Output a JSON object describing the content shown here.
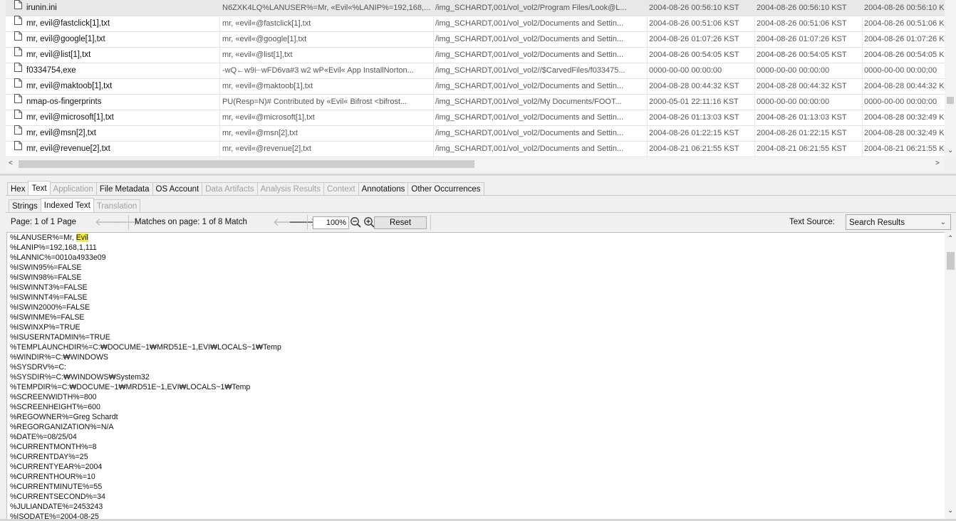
{
  "results": {
    "rows": [
      {
        "name": "irunin.ini",
        "keyword": "N6ZXK4LQ%LANUSER%=Mr, «Evil«%LANIP%=192,168,...",
        "path": "/img_SCHARDT,001/vol_vol2/Program Files/Look@L...",
        "modified": "2004-08-26 00:56:10 KST",
        "changed": "2004-08-26 00:56:10 KST",
        "accessed": "2004-08-26 00:56:10 K"
      },
      {
        "name": "mr, evil@fastclick[1],txt",
        "keyword": "mr, «evil«@fastclick[1],txt",
        "path": "/img_SCHARDT,001/vol_vol2/Documents and Settin...",
        "modified": "2004-08-26 00:51:06 KST",
        "changed": "2004-08-26 00:51:06 KST",
        "accessed": "2004-08-26 00:51:06 K"
      },
      {
        "name": "mr, evil@google[1],txt",
        "keyword": "mr, «evil«@google[1],txt",
        "path": "/img_SCHARDT,001/vol_vol2/Documents and Settin...",
        "modified": "2004-08-26 01:07:26 KST",
        "changed": "2004-08-26 01:07:26 KST",
        "accessed": "2004-08-26 01:07:26 K"
      },
      {
        "name": "mr, evil@list[1],txt",
        "keyword": "mr, «evil«@list[1],txt",
        "path": "/img_SCHARDT,001/vol_vol2/Documents and Settin...",
        "modified": "2004-08-26 00:54:05 KST",
        "changed": "2004-08-26 00:54:05 KST",
        "accessed": "2004-08-26 00:54:05 K"
      },
      {
        "name": "f0334754,exe",
        "keyword": "-wQ←w9⊢wFD6va#3 w2 wP«Evil« App InstallNorton...",
        "path": "/img_SCHARDT,001/vol_vol2//$CarvedFiles/f033475...",
        "modified": "0000-00-00 00:00:00",
        "changed": "0000-00-00 00:00:00",
        "accessed": "0000-00-00 00:00:00"
      },
      {
        "name": "mr, evil@maktoob[1],txt",
        "keyword": "mr, «evil«@maktoob[1],txt",
        "path": "/img_SCHARDT,001/vol_vol2/Documents and Settin...",
        "modified": "2004-08-28 00:44:32 KST",
        "changed": "2004-08-28 00:44:32 KST",
        "accessed": "2004-08-28 00:44:32 K"
      },
      {
        "name": "nmap-os-fingerprints",
        "keyword": "PU(Resp=N)# Contributed by «Evil« Bifrost <bifrost...",
        "path": "/img_SCHARDT,001/vol_vol2/My Documents/FOOT...",
        "modified": "2000-05-01 22:11:16 KST",
        "changed": "0000-00-00 00:00:00",
        "accessed": "0000-00-00 00:00:00"
      },
      {
        "name": "mr, evil@microsoft[1],txt",
        "keyword": "mr, «evil«@microsoft[1],txt",
        "path": "/img_SCHARDT,001/vol_vol2/Documents and Settin...",
        "modified": "2004-08-26 01:13:03 KST",
        "changed": "2004-08-26 01:13:03 KST",
        "accessed": "2004-08-28 00:32:49 K"
      },
      {
        "name": "mr, evil@msn[2],txt",
        "keyword": "mr, «evil«@msn[2],txt",
        "path": "/img_SCHARDT,001/vol_vol2/Documents and Settin...",
        "modified": "2004-08-26 01:22:15 KST",
        "changed": "2004-08-26 01:22:15 KST",
        "accessed": "2004-08-28 00:32:49 K"
      },
      {
        "name": "mr, evil@revenue[2],txt",
        "keyword": "mr, «evil«@revenue[2],txt",
        "path": "/img_SCHARDT,001/vol_vol2/Documents and Settin...",
        "modified": "2004-08-21 06:21:55 KST",
        "changed": "2004-08-21 06:21:55 KST",
        "accessed": "2004-08-21 06:21:55 K"
      }
    ]
  },
  "viewer_tabs": [
    {
      "label": "Hex",
      "state": "normal"
    },
    {
      "label": "Text",
      "state": "active"
    },
    {
      "label": "Application",
      "state": "disabled"
    },
    {
      "label": "File Metadata",
      "state": "normal"
    },
    {
      "label": "OS Account",
      "state": "normal"
    },
    {
      "label": "Data Artifacts",
      "state": "disabled"
    },
    {
      "label": "Analysis Results",
      "state": "disabled"
    },
    {
      "label": "Context",
      "state": "disabled"
    },
    {
      "label": "Annotations",
      "state": "normal"
    },
    {
      "label": "Other Occurrences",
      "state": "normal"
    }
  ],
  "text_tabs": [
    {
      "label": "Strings",
      "state": "normal"
    },
    {
      "label": "Indexed Text",
      "state": "active"
    },
    {
      "label": "Translation",
      "state": "disabled"
    }
  ],
  "toolbar": {
    "page_label": "Page: 1 of 1 Page",
    "matches_label": "Matches on page: 1 of 8 Match",
    "zoom_value": "100%",
    "reset_label": "Reset",
    "text_source_label": "Text Source:",
    "text_source_value": "Search Results"
  },
  "content": {
    "first_line_prefix": "%LANUSER%=Mr, ",
    "first_line_highlight": "Evil",
    "lines": [
      "%LANIP%=192,168,1,111",
      "%LANNIC%=0010a4933e09",
      "%ISWIN95%=FALSE",
      "%ISWIN98%=FALSE",
      "%ISWINNT3%=FALSE",
      "%ISWINNT4%=FALSE",
      "%ISWIN2000%=FALSE",
      "%ISWINME%=FALSE",
      "%ISWINXP%=TRUE",
      "%ISUSERNTADMIN%=TRUE",
      "%TEMPLAUNCHDIR%=C:₩DOCUME~1₩MRD51E~1,EVI₩LOCALS~1₩Temp",
      "%WINDIR%=C:₩WINDOWS",
      "%SYSDRV%=C:",
      "%SYSDIR%=C:₩WINDOWS₩System32",
      "%TEMPDIR%=C:₩DOCUME~1₩MRD51E~1,EVI₩LOCALS~1₩Temp",
      "%SCREENWIDTH%=800",
      "%SCREENHEIGHT%=600",
      "%REGOWNER%=Greg Schardt",
      "%REGORGANIZATION%=N/A",
      "%DATE%=08/25/04",
      "%CURRENTMONTH%=8",
      "%CURRENTDAY%=25",
      "%CURRENTYEAR%=2004",
      "%CURRENTHOUR%=10",
      "%CURRENTMINUTE%=55",
      "%CURRENTSECOND%=34",
      "%JULIANDATE%=2453243",
      "%ISODATE%=2004-08-25"
    ]
  },
  "colors": {
    "highlight": "#f5ef2a",
    "selected_row": "#e8e8e8",
    "disabled_text": "#a0a0a0"
  }
}
